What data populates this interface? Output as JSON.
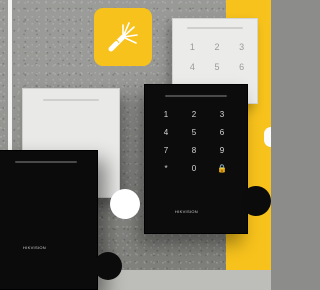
{
  "scene": {
    "colors": {
      "accent_yellow": "#f7c21c",
      "panel_white": "#e9e9e7",
      "panel_black": "#0c0c0c",
      "background_grey": "#8f8f8c"
    },
    "icons": {
      "badge": "cable-wires-icon",
      "black_keypad_lock": "lock-icon"
    },
    "white_keypad_keys": [
      "1",
      "2",
      "3",
      "4",
      "5",
      "6"
    ],
    "black_keypad_keys": [
      "1",
      "2",
      "3",
      "4",
      "5",
      "6",
      "7",
      "8",
      "9",
      "*",
      "0",
      "🔒"
    ],
    "brand_label": "HIKVISION"
  }
}
